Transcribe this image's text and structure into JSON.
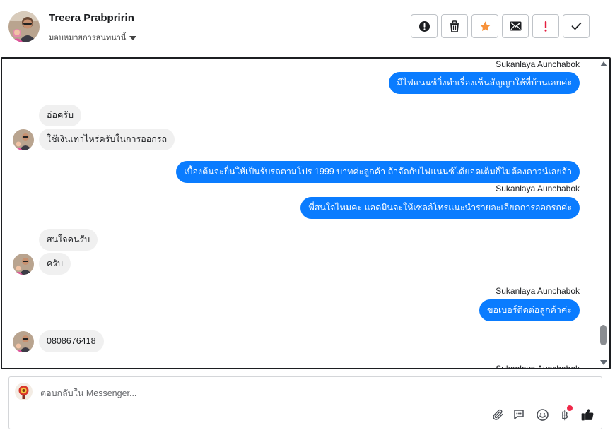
{
  "header": {
    "contact_name": "Treera Prabpririn",
    "assign_label": "มอบหมายการสนทนานี้",
    "toolbar": [
      {
        "name": "spam-button",
        "icon": "alert-circle-icon"
      },
      {
        "name": "delete-button",
        "icon": "trash-icon"
      },
      {
        "name": "star-button",
        "icon": "star-icon",
        "color": "#f7923b"
      },
      {
        "name": "unread-button",
        "icon": "envelope-icon"
      },
      {
        "name": "follow-up-button",
        "icon": "exclamation-icon",
        "color": "#e41e3f"
      },
      {
        "name": "done-button",
        "icon": "check-icon"
      }
    ]
  },
  "conversation": {
    "messages": [
      {
        "direction": "out",
        "sender": "Sukanlaya Aunchabok",
        "text": "มีไฟแนนซ์วิ่งทำเรื่องเซ็นสัญญาให้ที่บ้านเลยค่ะ"
      },
      {
        "direction": "in",
        "text": "อ่อครับ"
      },
      {
        "direction": "in",
        "text": "ใช้เงินเท่าไหร่ครับในการออกรถ"
      },
      {
        "direction": "out",
        "text": "เบื้องต้นจะยื่นให้เป็นรับรถตามโปร 1999 บาทค่ะลูกค้า ถ้าจัดกับไฟแนนซ์ได้ยอดเต็มก็ไม่ต้องดาวน์เลยจ้า"
      },
      {
        "direction": "out",
        "sender": "Sukanlaya Aunchabok",
        "text": "พี่สนใจไหมคะ แอดมินจะให้เซลล์โทรแนะนำรายละเอียดการออกรถค่ะ"
      },
      {
        "direction": "in",
        "text": "สนใจคนรับ"
      },
      {
        "direction": "in",
        "text": "ครับ"
      },
      {
        "direction": "out",
        "sender": "Sukanlaya Aunchabok",
        "text": "ขอเบอร์ติดต่อลูกค้าค่ะ"
      },
      {
        "direction": "in",
        "text": "0808676418"
      }
    ],
    "trailing_sender": "Sukanlaya Aunchabok"
  },
  "composer": {
    "placeholder": "ตอบกลับใน Messenger...",
    "icons": [
      "paperclip-icon",
      "saved-replies-icon",
      "emoji-icon",
      "baht-payment-icon",
      "like-icon"
    ],
    "baht_symbol": "฿"
  },
  "colors": {
    "outgoing_bubble": "#0a7cff",
    "incoming_bubble": "#f0f0f0",
    "star": "#f7923b",
    "follow_up": "#e41e3f",
    "notification_dot": "#f02849"
  }
}
